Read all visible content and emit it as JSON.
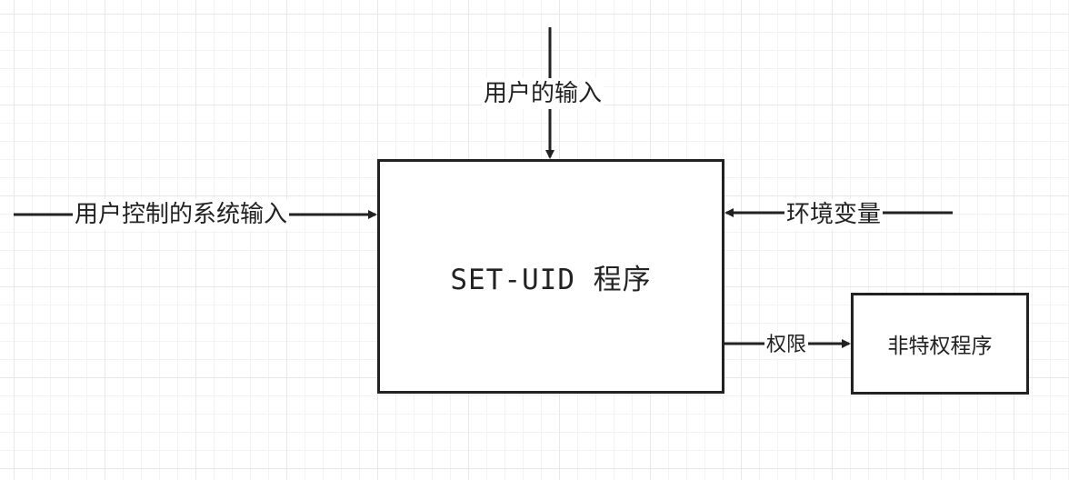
{
  "nodes": {
    "main": "SET-UID 程序",
    "sub": "非特权程序"
  },
  "edges": {
    "user_input": "用户的输入",
    "control_input": "用户控制的系统输入",
    "env": "环境变量",
    "priv": "权限"
  },
  "colors": {
    "line": "#222222",
    "grid": "#e8e8e8",
    "background": "#ffffff"
  }
}
